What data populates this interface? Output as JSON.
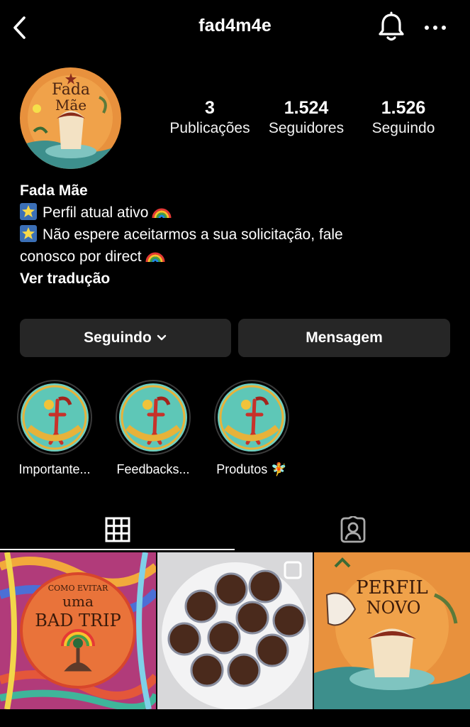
{
  "header": {
    "username": "fad4m4e"
  },
  "stats": [
    {
      "value": "3",
      "label": "Publicações"
    },
    {
      "value": "1.524",
      "label": "Seguidores"
    },
    {
      "value": "1.526",
      "label": "Seguindo"
    }
  ],
  "avatar": {
    "text_line1": "Fada",
    "text_line2": "Mãe"
  },
  "bio": {
    "name": "Fada Mãe",
    "line1": "Perfil atual ativo",
    "line2": "Não espere aceitarmos a sua solicitação, fale",
    "line3": "conosco por direct",
    "translate": "Ver tradução"
  },
  "buttons": {
    "following": "Seguindo",
    "message": "Mensagem"
  },
  "highlights": [
    {
      "label": "Importante..."
    },
    {
      "label": "Feedbacks..."
    },
    {
      "label": "Produtos 🧚"
    }
  ],
  "posts": [
    {
      "line1": "COMO EVITAR",
      "line2": "uma",
      "line3": "BAD TRIP"
    },
    {
      "kind": "photo"
    },
    {
      "line1": "PERFIL",
      "line2": "NOVO"
    }
  ]
}
